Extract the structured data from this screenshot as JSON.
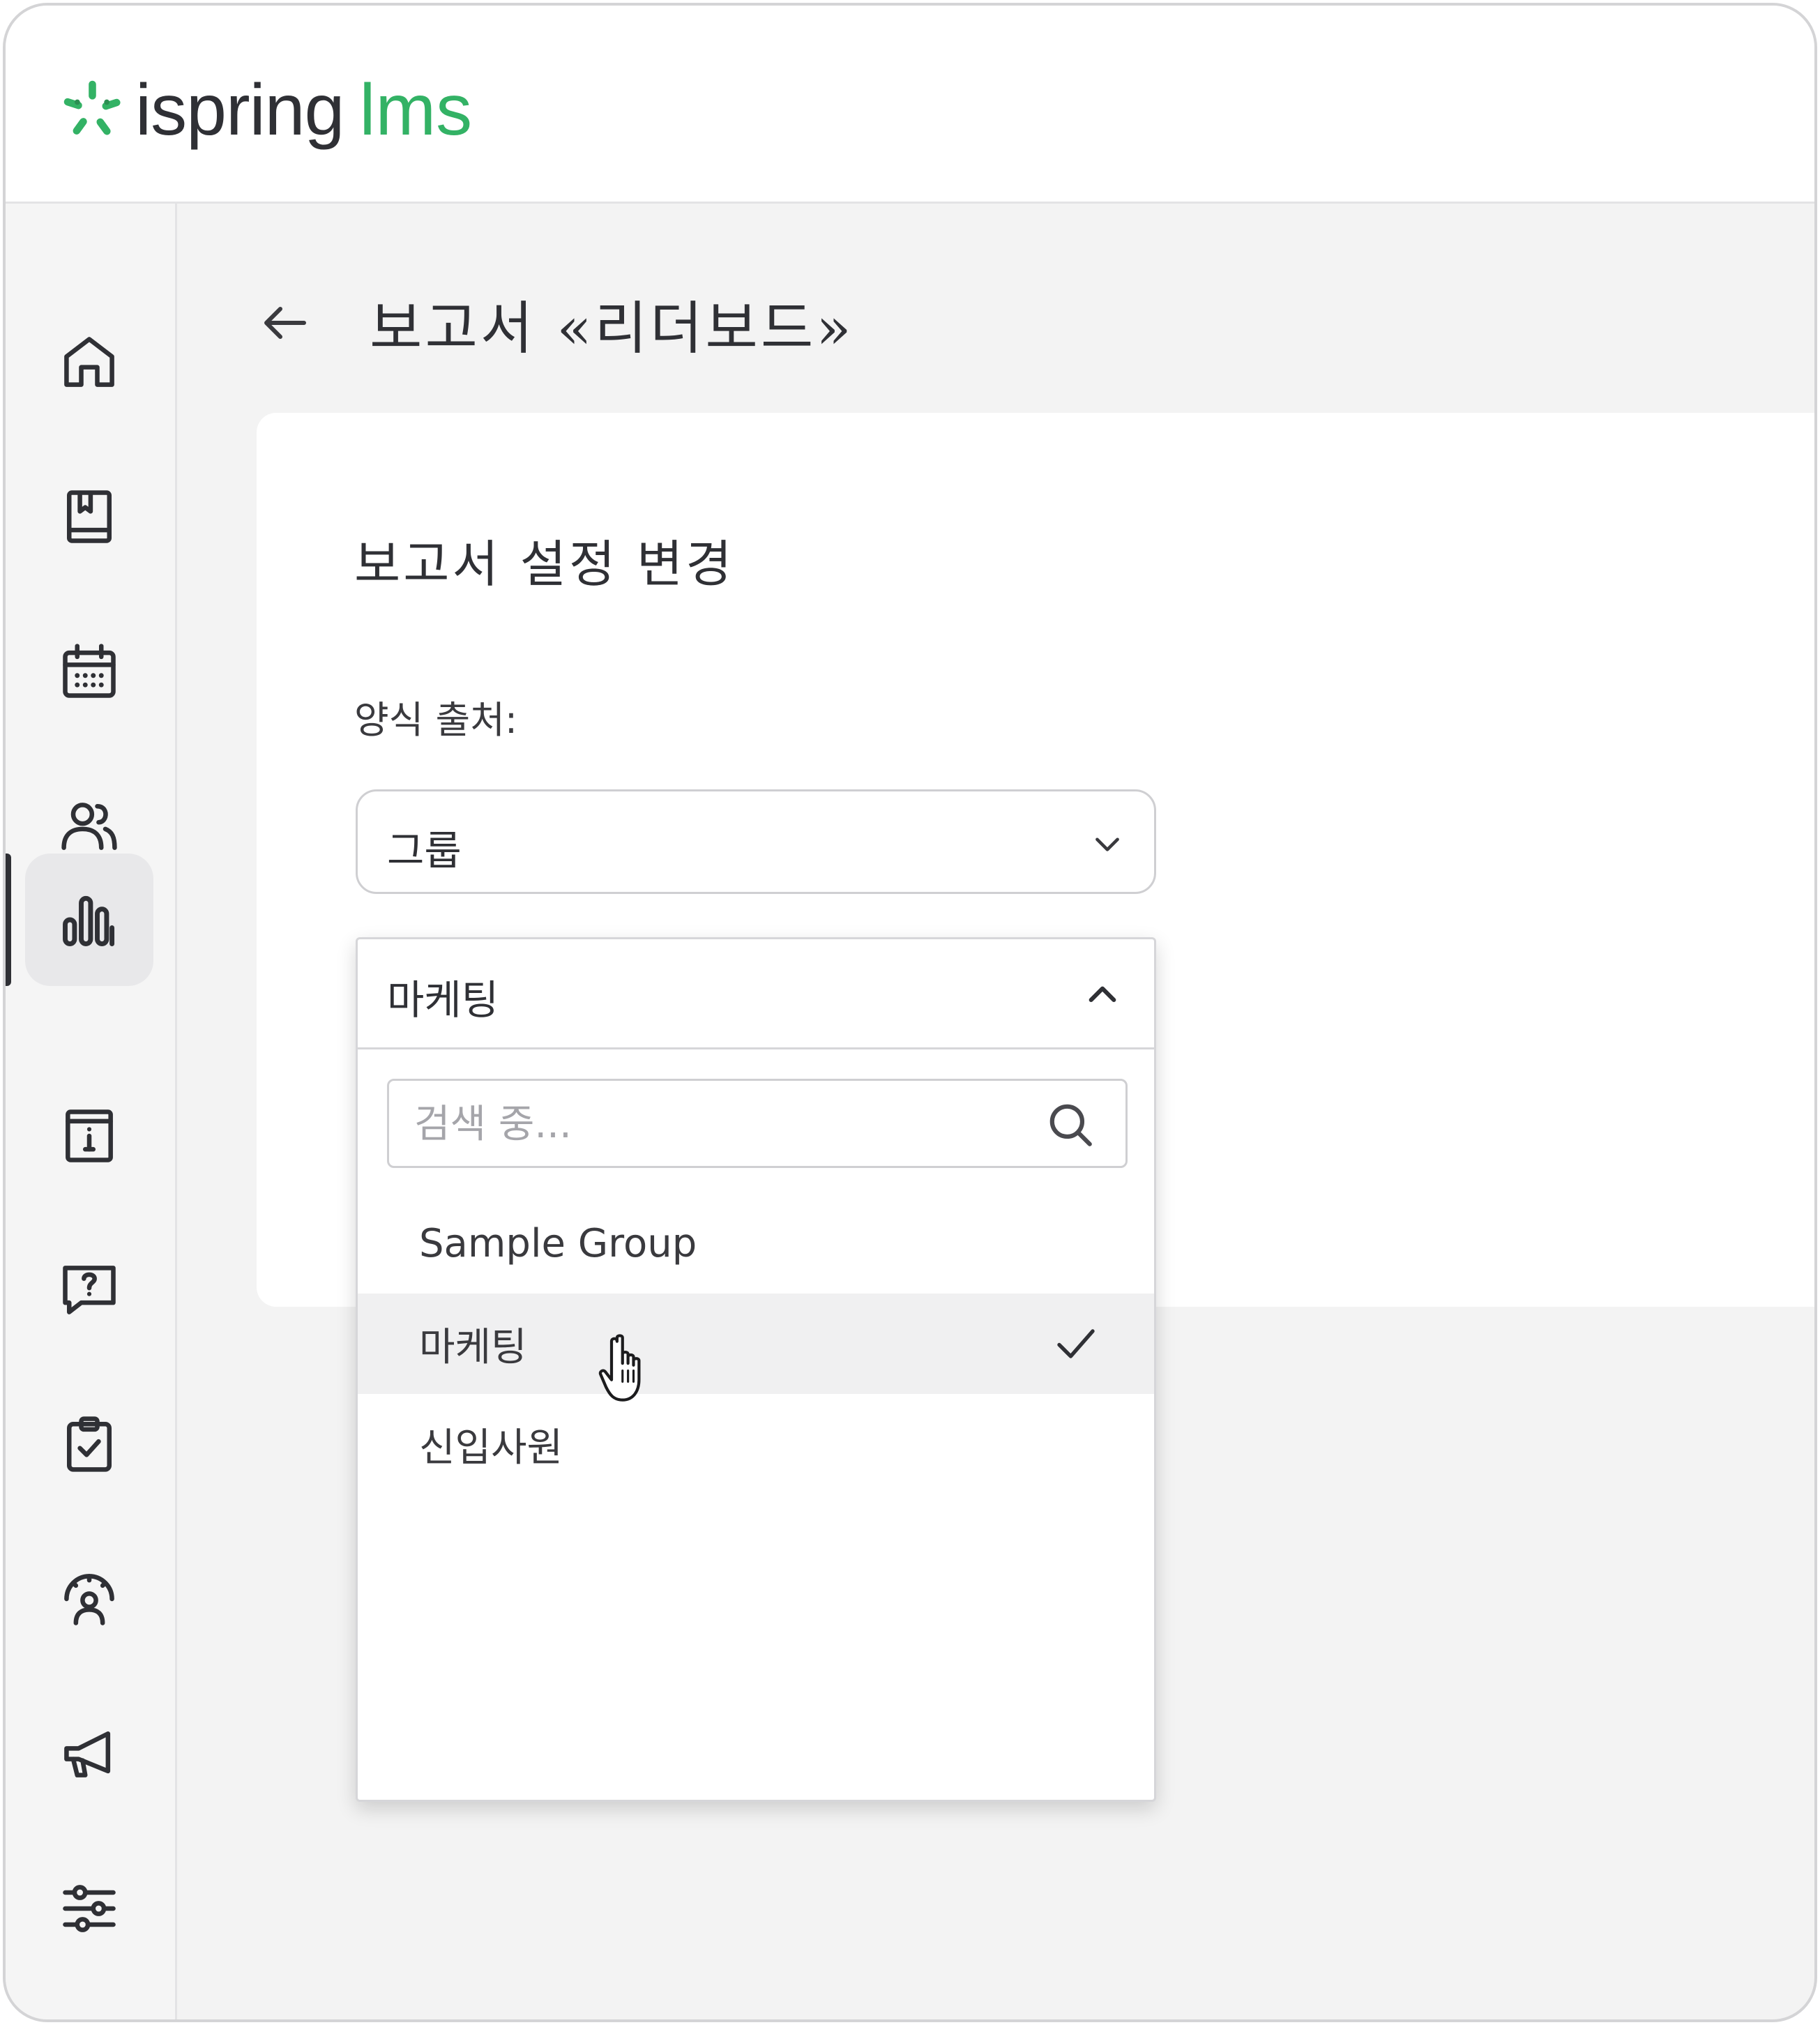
{
  "header": {
    "logo_brand": "ispring",
    "logo_product": "lms"
  },
  "sidebar": {
    "items": [
      {
        "icon": "home-icon"
      },
      {
        "icon": "book-icon"
      },
      {
        "icon": "calendar-icon"
      },
      {
        "icon": "users-icon"
      },
      {
        "icon": "bar-chart-icon",
        "active": true
      },
      {
        "icon": "info-card-icon"
      },
      {
        "icon": "help-chat-icon"
      },
      {
        "icon": "clipboard-check-icon"
      },
      {
        "icon": "user-gauge-icon"
      },
      {
        "icon": "megaphone-icon"
      },
      {
        "icon": "sliders-icon"
      }
    ]
  },
  "page": {
    "title": "보고서 «리더보드»"
  },
  "card": {
    "title": "보고서 설정 변경",
    "source_label": "양식 출처:",
    "source_select_value": "그룹"
  },
  "dropdown": {
    "selected_value": "마케팅",
    "search_placeholder": "검색 중...",
    "options": [
      {
        "label": "Sample Group"
      },
      {
        "label": "마케팅",
        "selected": true
      },
      {
        "label": "신입사원"
      }
    ]
  },
  "colors": {
    "brand_green": "#33b265",
    "text_dark": "#2f3035",
    "background": "#f3f3f3"
  }
}
